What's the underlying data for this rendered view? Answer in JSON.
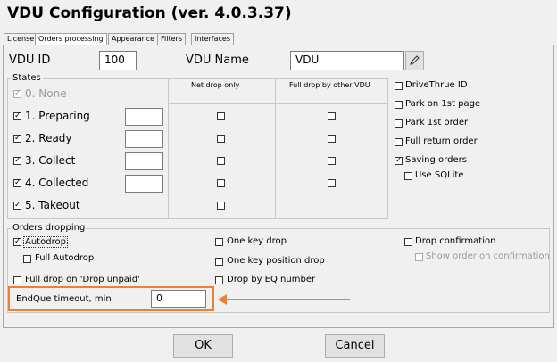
{
  "window": {
    "title": "VDU Configuration (ver. 4.0.3.37)"
  },
  "tabs": [
    "License",
    "Orders processing",
    "Appearance",
    "Filters",
    "Interfaces"
  ],
  "vdu_id": {
    "label": "VDU ID",
    "value": "100"
  },
  "vdu_name": {
    "label": "VDU Name",
    "value": "VDU"
  },
  "states": {
    "group_label": "States",
    "col_net": "Net drop only",
    "col_full": "Full drop by other VDU",
    "rows": [
      {
        "label": "0. None"
      },
      {
        "label": "1. Preparing"
      },
      {
        "label": "2. Ready"
      },
      {
        "label": "3. Collect"
      },
      {
        "label": "4. Collected"
      },
      {
        "label": "5. Takeout"
      }
    ]
  },
  "options": {
    "drive_thru": "DriveThrue ID",
    "park_first_page": "Park on 1st page",
    "park_first_order": "Park 1st order",
    "full_return": "Full return order",
    "saving_orders": "Saving orders",
    "use_sqlite": "Use SQLite"
  },
  "orders_dropping": {
    "group_label": "Orders dropping",
    "autodrop": "Autodrop",
    "full_autodrop": "Full Autodrop",
    "full_drop_unpaid": "Full drop on 'Drop unpaid'",
    "one_key_drop": "One key drop",
    "one_key_position_drop": "One key position drop",
    "drop_by_eq": "Drop by EQ number",
    "drop_confirmation": "Drop confirmation",
    "show_order_on_confirmation": "Show order on confirmation",
    "endque_label": "EndQue timeout, min",
    "endque_value": "0"
  },
  "buttons": {
    "ok": "OK",
    "cancel": "Cancel"
  },
  "colors": {
    "highlight": "#ee8033"
  },
  "icons": {
    "edit": "pencil-icon"
  }
}
